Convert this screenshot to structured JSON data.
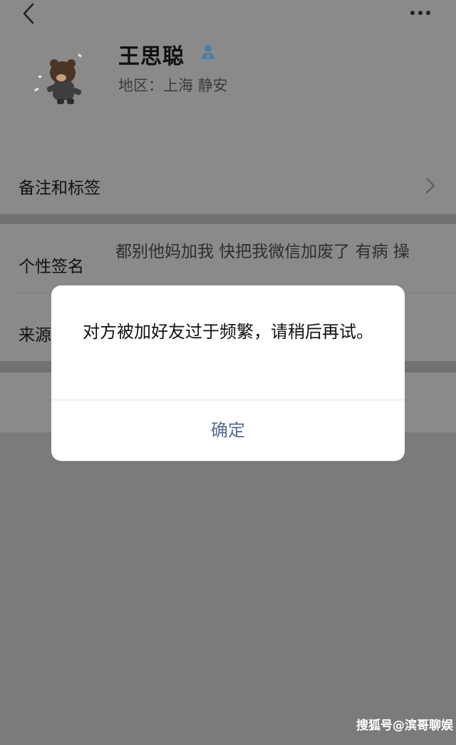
{
  "profile": {
    "name": "王思聪",
    "region": "地区：上海 静安"
  },
  "rows": {
    "remark_label": "备注和标签",
    "signature_label": "个性签名",
    "signature_value": "都别他妈加我 快把我微信加废了 有病 操",
    "source_label": "来源"
  },
  "dialog": {
    "message": "对方被加好友过于频繁，请稍后再试。",
    "confirm_label": "确定"
  },
  "watermark": "搜狐号@滨哥聊娱",
  "colors": {
    "dialog_button": "#576b95",
    "overlay_page": "#8a8a8a"
  },
  "icons": [
    "back-arrow-icon",
    "more-dots-icon",
    "verified-user-icon",
    "chevron-right-icon",
    "bear-avatar"
  ]
}
